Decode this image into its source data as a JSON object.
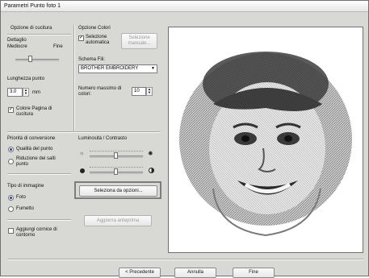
{
  "window": {
    "title": "Parametri Punto foto 1"
  },
  "opzione_cucitura": {
    "group_label": "Opzione di cucitura",
    "dettaglio_label": "Dettaglio",
    "mediocre_label": "Mediocre",
    "fine_label": "Fine",
    "lunghezza_label": "Lunghezza punto",
    "lunghezza_value": "3.0",
    "unit": "mm",
    "colore_pagina_label": "Colore Pagina di cucitura"
  },
  "opzione_colori": {
    "group_label": "Opzione Colori",
    "selezione_auto_label": "Selezione automatica",
    "selezione_manuale_label": "Selezione manuale...",
    "schema_label": "Schema Fili:",
    "schema_value": "BROTHER EMBROIDERY",
    "numero_label": "Numero massimo di colori:",
    "numero_value": "10"
  },
  "priorita": {
    "label": "Priorità di conversione",
    "qualita_label": "Qualità del punto",
    "riduzione_label": "Riduzione dei salti punto"
  },
  "luminosita": {
    "label": "Luminosità / Contrasto"
  },
  "tipo_immagine": {
    "label": "Tipo di immagine",
    "foto_label": "Foto",
    "fumetto_label": "Fumetto"
  },
  "buttons": {
    "seleziona_opzioni": "Seleziona da opzioni...",
    "aggiorna": "Aggiorna anteprima",
    "aggiungi_cornice": "Aggiungi cornice di contorno",
    "precedente": "< Precedente",
    "annulla": "Annulla",
    "fine": "Fine"
  },
  "icons": {
    "sun_low": "sun-icon",
    "sun_high": "sun-bright-icon",
    "contrast_low": "contrast-low-icon",
    "contrast_high": "contrast-high-icon"
  }
}
